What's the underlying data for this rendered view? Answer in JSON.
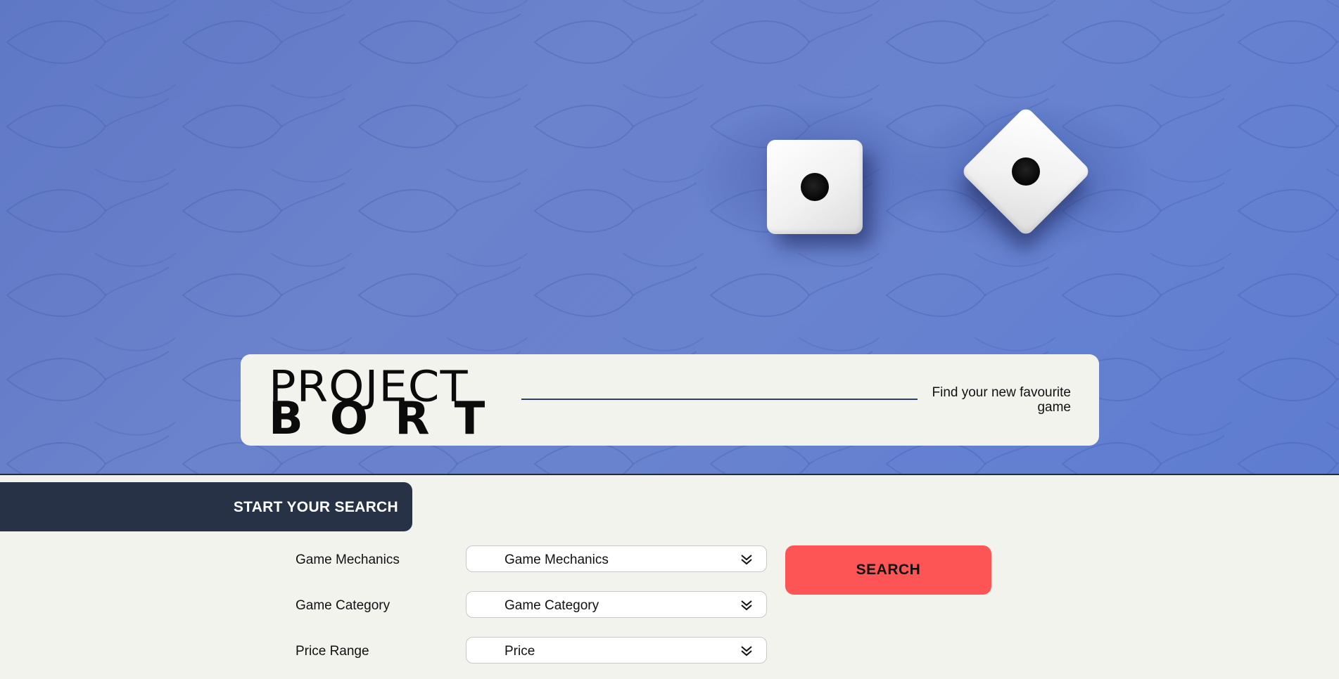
{
  "brand": {
    "logo_line1": "PROJECT",
    "logo_line2": "BORT",
    "tagline": "Find your new favourite game"
  },
  "search_section": {
    "heading": "START YOUR SEARCH",
    "filters": [
      {
        "label": "Game Mechanics",
        "selected": "Game Mechanics"
      },
      {
        "label": "Game Category",
        "selected": "Game Category"
      },
      {
        "label": "Price Range",
        "selected": "Price"
      }
    ],
    "search_button": "SEARCH"
  },
  "colors": {
    "hero_blue": "#6b82cc",
    "dark_navy": "#273247",
    "accent_red": "#fd5556",
    "page_bg": "#f3f3ee"
  },
  "icons": {
    "dropdown": "double-chevron-down-icon"
  }
}
